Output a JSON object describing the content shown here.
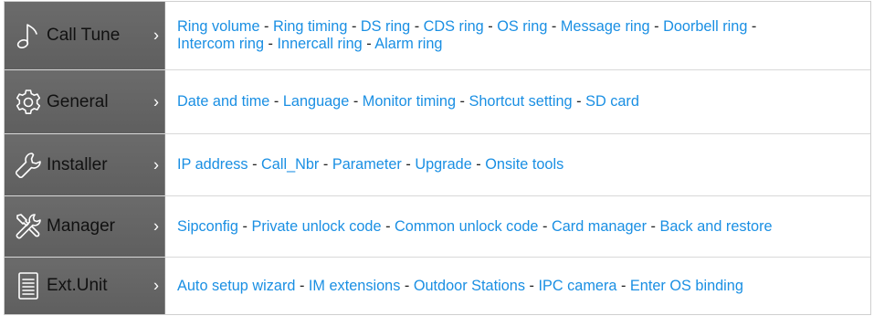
{
  "menu": [
    {
      "label": "Call Tune",
      "icon": "music-note-icon",
      "chevron": "›",
      "links": [
        "Ring volume",
        "Ring timing",
        "DS ring",
        "CDS ring",
        "OS ring",
        "Message ring",
        "Doorbell ring",
        "Intercom ring",
        "Innercall ring",
        "Alarm ring"
      ]
    },
    {
      "label": "General",
      "icon": "gear-icon",
      "chevron": "›",
      "links": [
        "Date and time",
        "Language",
        "Monitor timing",
        "Shortcut setting",
        "SD card"
      ]
    },
    {
      "label": "Installer",
      "icon": "wrench-icon",
      "chevron": "›",
      "links": [
        "IP address",
        "Call_Nbr",
        "Parameter",
        "Upgrade",
        "Onsite tools"
      ]
    },
    {
      "label": "Manager",
      "icon": "tools-icon",
      "chevron": "›",
      "links": [
        "Sipconfig",
        "Private unlock code",
        "Common unlock code",
        "Card manager",
        "Back and restore"
      ]
    },
    {
      "label": "Ext.Unit",
      "icon": "document-icon",
      "chevron": "›",
      "links": [
        "Auto setup wizard",
        "IM extensions",
        "Outdoor Stations",
        "IPC camera",
        "Enter OS binding"
      ]
    }
  ],
  "separator": " - ",
  "colors": {
    "link": "#1a8fe3",
    "sidebar": "#666666",
    "separator": "#222222"
  }
}
